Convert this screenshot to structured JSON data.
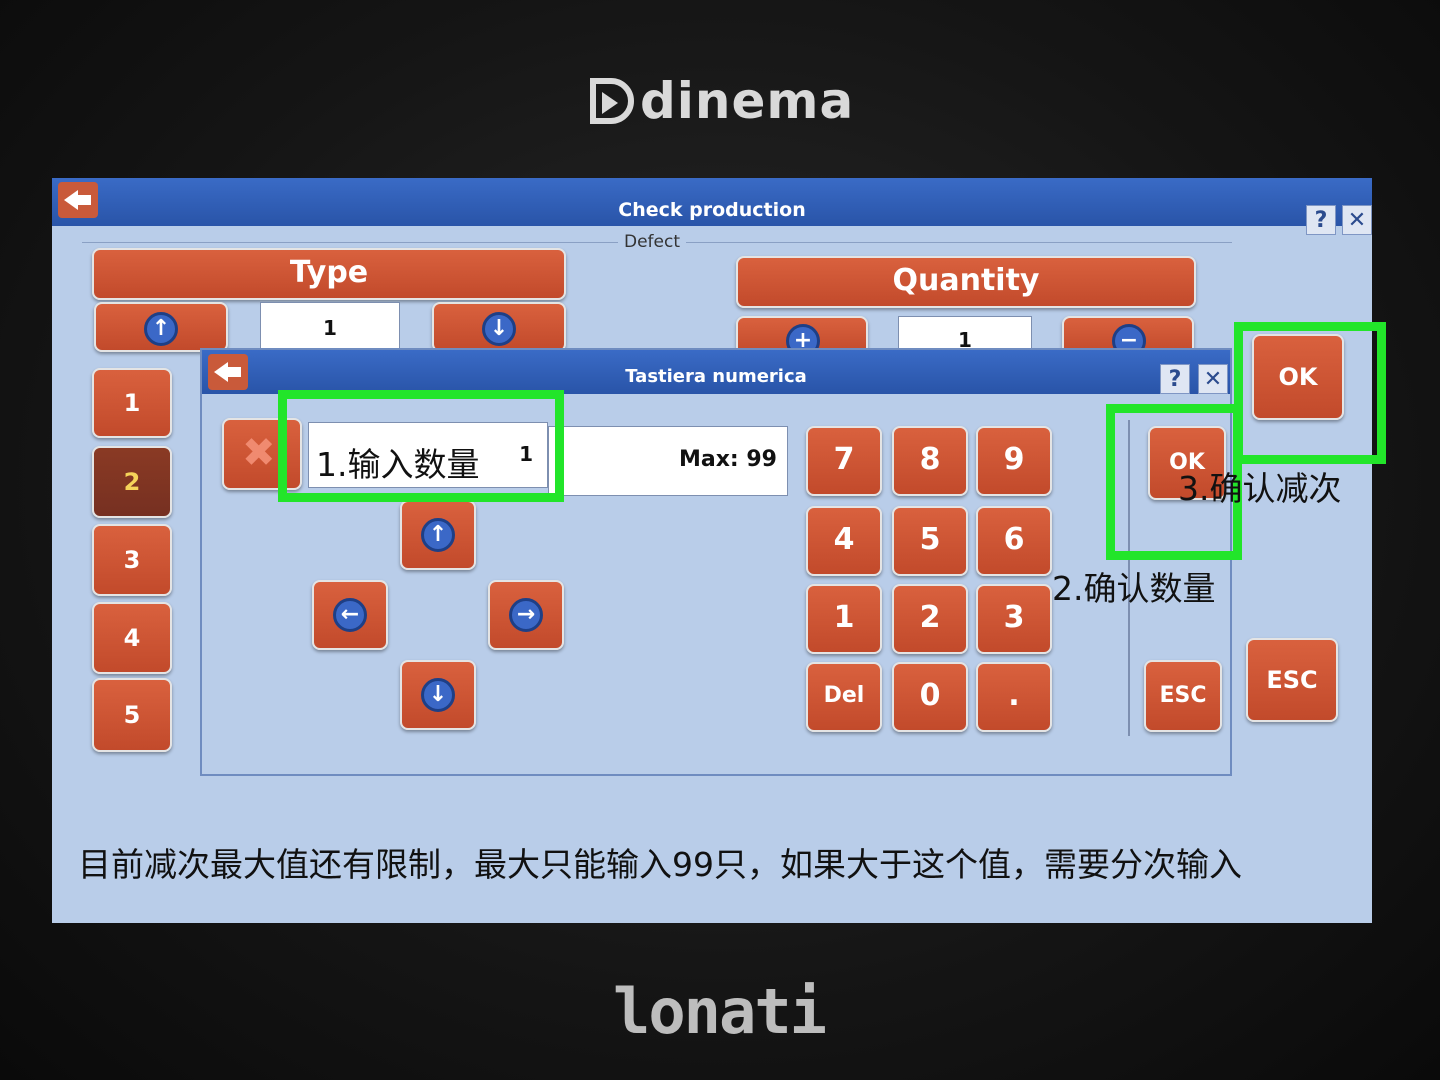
{
  "brand": {
    "top": "dinema",
    "bottom": "lonati"
  },
  "window": {
    "title": "Check production",
    "help_label": "?",
    "close_label": "✕",
    "group_label": "Defect",
    "type_label": "Type",
    "quantity_label": "Quantity",
    "type_value": "1",
    "quantity_value": "1",
    "ok_label": "OK",
    "esc_label": "ESC",
    "list_items": [
      "1",
      "2",
      "3",
      "4",
      "5"
    ],
    "selected_item": "2"
  },
  "dialog": {
    "title": "Tastiera numerica",
    "help_label": "?",
    "close_label": "✕",
    "input_value": "1",
    "max_label": "Max: 99",
    "keypad": [
      "7",
      "8",
      "9",
      "4",
      "5",
      "6",
      "1",
      "2",
      "3",
      "Del",
      "0",
      "."
    ],
    "ok_label": "OK",
    "esc_label": "ESC"
  },
  "annotations": {
    "step1": "1.输入数量",
    "step2": "2.确认数量",
    "step3": "3.确认减次",
    "note": "目前减次最大值还有限制，最大只能输入99只，如果大于这个值，需要分次输入"
  },
  "colors": {
    "button": "#c95a3a",
    "titlebar": "#2f5db5",
    "screen": "#b9cde9",
    "highlight": "#22e52a"
  }
}
